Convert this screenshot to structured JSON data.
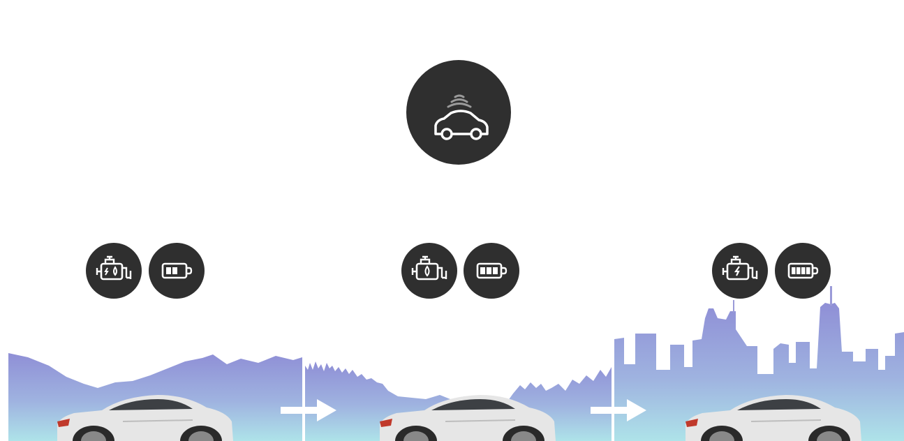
{
  "colors": {
    "icon_circle": "#2f2f2f",
    "icon_stroke": "#ffffff",
    "signal_grey": "#9a9a9a",
    "scenery_top": "#8c93d6",
    "scenery_bottom": "#a9dde7",
    "car_body": "#e6e6e6",
    "arrow": "#ffffff"
  },
  "top_icon": {
    "icon": "connected-car-icon"
  },
  "stages": [
    {
      "scene": "mountains",
      "engine_icon": "engine-fuel-and-electric-icon",
      "battery_icon": "battery-low-icon",
      "battery_level": 0.5
    },
    {
      "scene": "forest",
      "engine_icon": "engine-fuel-icon",
      "battery_icon": "battery-medium-icon",
      "battery_level": 0.75
    },
    {
      "scene": "city",
      "engine_icon": "engine-electric-icon",
      "battery_icon": "battery-full-icon",
      "battery_level": 1.0
    }
  ],
  "arrows": [
    {
      "icon": "arrow-right-icon"
    },
    {
      "icon": "arrow-right-icon"
    }
  ]
}
